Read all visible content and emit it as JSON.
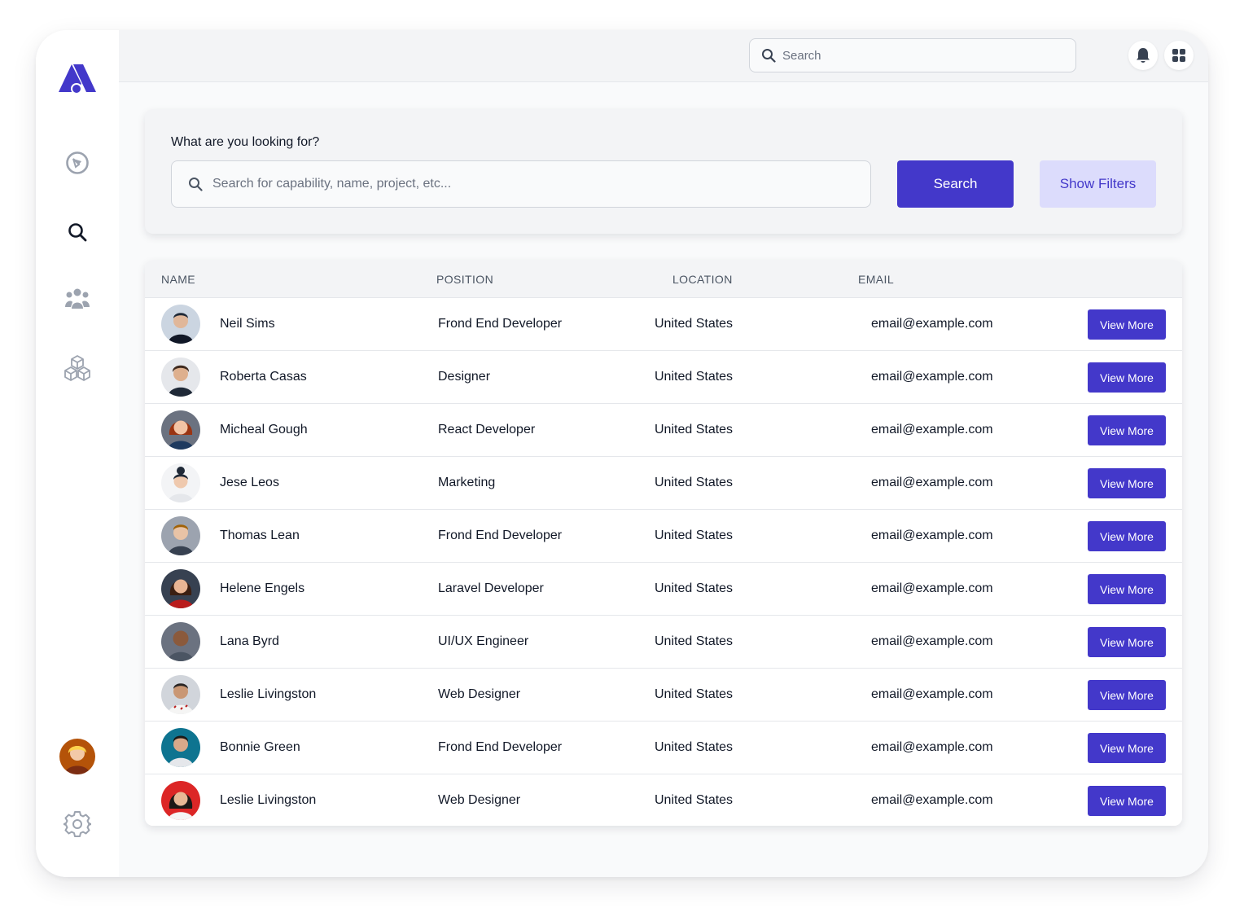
{
  "brand": {
    "accent": "#4338ca",
    "accent_light": "#dcdcfc"
  },
  "topbar": {
    "search_placeholder": "Search",
    "icons": [
      "bell-icon",
      "apps-grid-icon"
    ]
  },
  "sidebar": {
    "items": [
      {
        "icon": "compass-icon"
      },
      {
        "icon": "search-icon"
      },
      {
        "icon": "users-icon"
      },
      {
        "icon": "cubes-icon"
      }
    ],
    "bottom": [
      "avatar",
      "gear-icon"
    ]
  },
  "search_panel": {
    "label": "What are you looking for?",
    "placeholder": "Search for capability, name, project, etc...",
    "search_button": "Search",
    "filters_button": "Show Filters"
  },
  "table": {
    "headers": [
      "NAME",
      "POSITION",
      "LOCATION",
      "EMAIL"
    ],
    "action_label": "View More",
    "rows": [
      {
        "name": "Neil Sims",
        "position": "Frond End Developer",
        "location": "United States",
        "email": "email@example.com"
      },
      {
        "name": "Roberta Casas",
        "position": "Designer",
        "location": "United States",
        "email": "email@example.com"
      },
      {
        "name": "Micheal Gough",
        "position": "React Developer",
        "location": "United States",
        "email": "email@example.com"
      },
      {
        "name": "Jese Leos",
        "position": "Marketing",
        "location": "United States",
        "email": "email@example.com"
      },
      {
        "name": "Thomas Lean",
        "position": "Frond End Developer",
        "location": "United States",
        "email": "email@example.com"
      },
      {
        "name": "Helene Engels",
        "position": "Laravel Developer",
        "location": "United States",
        "email": "email@example.com"
      },
      {
        "name": "Lana Byrd",
        "position": "UI/UX Engineer",
        "location": "United States",
        "email": "email@example.com"
      },
      {
        "name": "Leslie Livingston",
        "position": "Web Designer",
        "location": "United States",
        "email": "email@example.com"
      },
      {
        "name": "Bonnie Green",
        "position": "Frond End Developer",
        "location": "United States",
        "email": "email@example.com"
      },
      {
        "name": "Leslie Livingston",
        "position": "Web Designer",
        "location": "United States",
        "email": "email@example.com"
      }
    ]
  }
}
